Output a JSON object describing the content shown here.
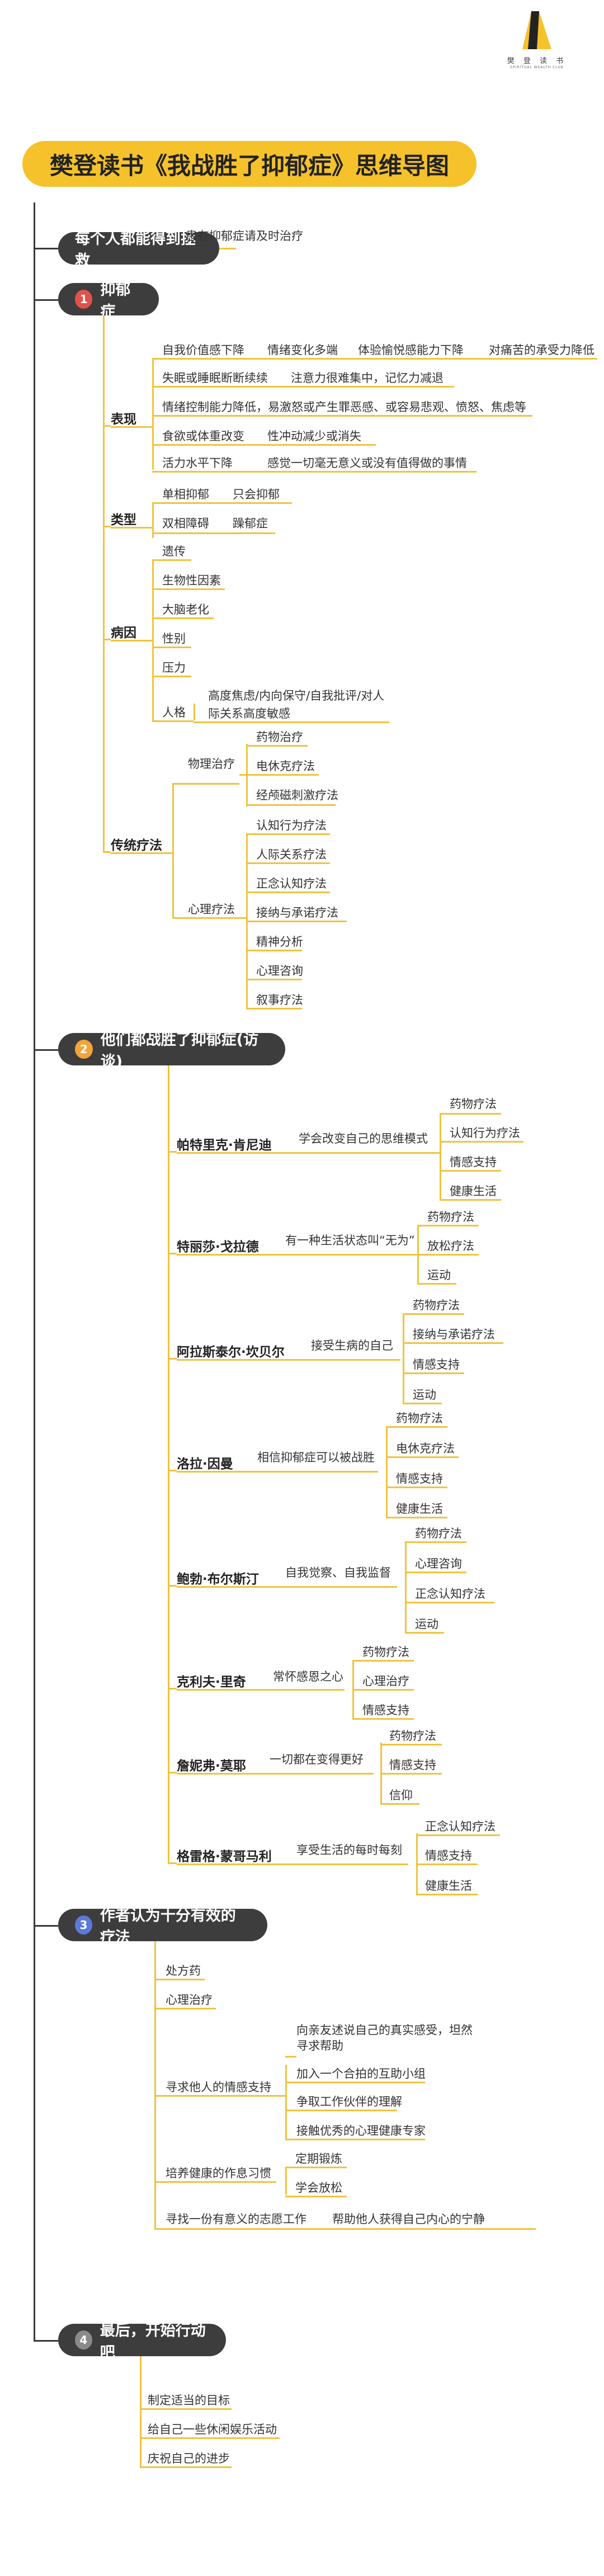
{
  "logo": {
    "brand": "樊 登 读 书",
    "sub": "SPIRITUAL WEALTH CLUB"
  },
  "title": "樊登读书《我战胜了抑郁症》思维导图",
  "intro": {
    "label": "每个人都能得到拯救",
    "child": "患有抑郁症请及时治疗"
  },
  "s1": {
    "num": "1",
    "label": "抑郁症",
    "biaoxian": {
      "label": "表现",
      "items": [
        "自我价值感下降",
        "情绪变化多端",
        "体验愉悦感能力下降",
        "对痛苦的承受力降低",
        "失眠或睡眠断断续续",
        "注意力很难集中，记忆力减退",
        "情绪控制能力降低，易激怒或产生罪恶感、或容易悲观、愤怒、焦虑等",
        "食欲或体重改变",
        "性冲动减少或消失",
        "活力水平下降",
        "感觉一切毫无意义或没有值得做的事情"
      ]
    },
    "leixing": {
      "label": "类型",
      "items": [
        "单相抑郁",
        "只会抑郁",
        "双相障碍",
        "躁郁症"
      ]
    },
    "bingyin": {
      "label": "病因",
      "items": [
        "遗传",
        "生物性因素",
        "大脑老化",
        "性别",
        "压力",
        "人格"
      ],
      "renge_child1": "高度焦虑/内向保守/自我批评/对人",
      "renge_child2": "际关系高度敏感"
    },
    "liaofa": {
      "label": "传统疗法",
      "wuli": {
        "label": "物理治疗",
        "items": [
          "药物治疗",
          "电休克疗法",
          "经颅磁刺激疗法"
        ]
      },
      "xinli": {
        "label": "心理疗法",
        "items": [
          "认知行为疗法",
          "人际关系疗法",
          "正念认知疗法",
          "接纳与承诺疗法",
          "精神分析",
          "心理咨询",
          "叙事疗法"
        ]
      }
    }
  },
  "s2": {
    "num": "2",
    "label": "他们都战胜了抑郁症(访谈)",
    "people": [
      {
        "name": "帕特里克·肯尼迪",
        "desc": "学会改变自己的思维模式",
        "items": [
          "药物疗法",
          "认知行为疗法",
          "情感支持",
          "健康生活"
        ]
      },
      {
        "name": "特丽莎·戈拉德",
        "desc": "有一种生活状态叫“无为”",
        "items": [
          "药物疗法",
          "放松疗法",
          "运动"
        ]
      },
      {
        "name": "阿拉斯泰尔·坎贝尔",
        "desc": "接受生病的自己",
        "items": [
          "药物疗法",
          "接纳与承诺疗法",
          "情感支持",
          "运动"
        ]
      },
      {
        "name": "洛拉·因曼",
        "desc": "相信抑郁症可以被战胜",
        "items": [
          "药物疗法",
          "电休克疗法",
          "情感支持",
          "健康生活"
        ]
      },
      {
        "name": "鲍勃·布尔斯汀",
        "desc": "自我觉察、自我监督",
        "items": [
          "药物疗法",
          "心理咨询",
          "正念认知疗法",
          "运动"
        ]
      },
      {
        "name": "克利夫·里奇",
        "desc": "常怀感恩之心",
        "items": [
          "药物疗法",
          "心理治疗",
          "情感支持"
        ]
      },
      {
        "name": "詹妮弗·莫耶",
        "desc": "一切都在变得更好",
        "items": [
          "药物疗法",
          "情感支持",
          "信仰"
        ]
      },
      {
        "name": "格雷格·蒙哥马利",
        "desc": "享受生活的每时每刻",
        "items": [
          "正念认知疗法",
          "情感支持",
          "健康生活"
        ]
      }
    ]
  },
  "s3": {
    "num": "3",
    "label": "作者认为十分有效的疗法",
    "items": [
      "处方药",
      "心理治疗",
      "寻求他人的情感支持",
      "培养健康的作息习惯",
      "寻找一份有意义的志愿工作"
    ],
    "qinggan": [
      "向亲友述说自己的真实感受，坦然寻求帮助",
      "加入一个合拍的互助小组",
      "争取工作伙伴的理解",
      "接触优秀的心理健康专家"
    ],
    "qinggan_first1": "向亲友述说自己的真实感受，坦然",
    "qinggan_first2": "寻求帮助",
    "zuoxi": [
      "定期锻炼",
      "学会放松"
    ],
    "zhiyuan": "帮助他人获得自己内心的宁静"
  },
  "s4": {
    "num": "4",
    "label": "最后，开始行动吧",
    "items": [
      "制定适当的目标",
      "给自己一些休闲娱乐活动",
      "庆祝自己的进步"
    ]
  },
  "colors": {
    "accent": "#f6c22b",
    "pill": "#3d3d3d",
    "line": "#f0c340",
    "n1": "#e0524a",
    "n2": "#f1a53a",
    "n3": "#5b7ad8",
    "n4": "#8a8a8a"
  }
}
